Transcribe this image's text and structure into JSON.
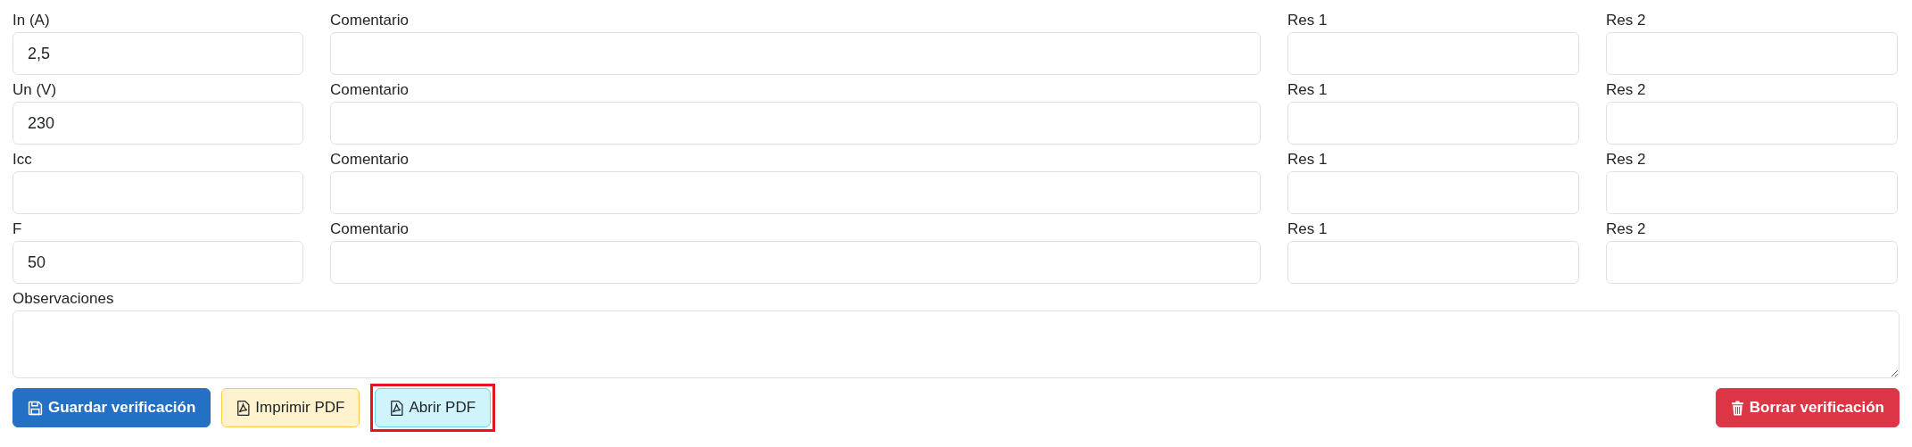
{
  "rows": [
    {
      "label": "In (A)",
      "value": "2,5",
      "comment_label": "Comentario",
      "res1_label": "Res 1",
      "res2_label": "Res 2"
    },
    {
      "label": "Un (V)",
      "value": "230",
      "comment_label": "Comentario",
      "res1_label": "Res 1",
      "res2_label": "Res 2"
    },
    {
      "label": "Icc",
      "comment_label": "Comentario",
      "res1_label": "Res 1",
      "res2_label": "Res 2"
    },
    {
      "label": "F",
      "value": "50",
      "comment_label": "Comentario",
      "res1_label": "Res 1",
      "res2_label": "Res 2"
    }
  ],
  "observations": {
    "label": "Observaciones"
  },
  "buttons": [
    {
      "label": "Guardar verificación",
      "kind": "save",
      "highlighted": false
    },
    {
      "label": "Imprimir PDF",
      "kind": "print",
      "highlighted": false
    },
    {
      "label": "Abrir PDF",
      "kind": "open",
      "highlighted": true
    },
    {
      "label": "Borrar verificación",
      "kind": "delete",
      "highlighted": false
    }
  ]
}
